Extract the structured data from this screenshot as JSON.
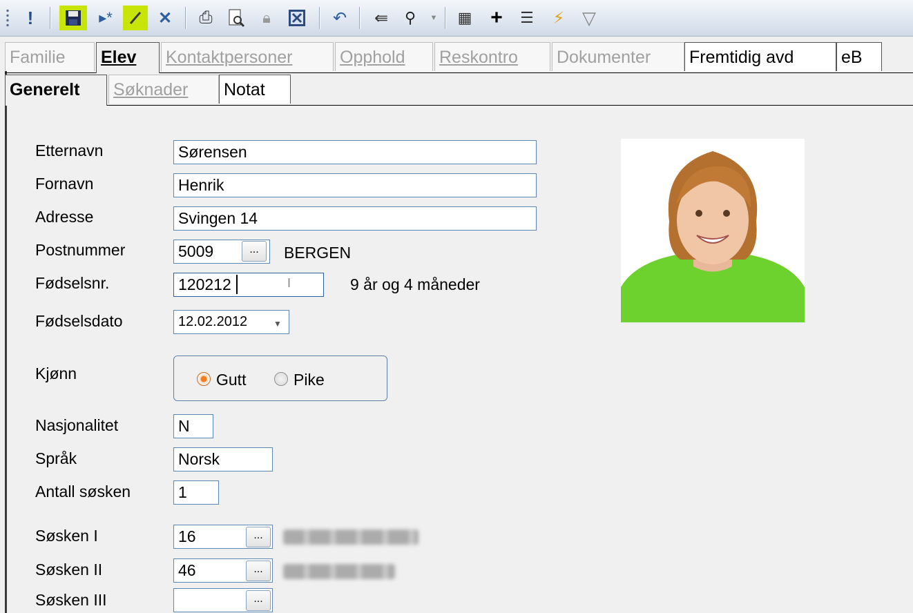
{
  "toolbar": {
    "icons": [
      "grip-icon",
      "exclamation-icon",
      "save-icon",
      "new-record-icon",
      "edit-icon",
      "delete-icon",
      "print-icon",
      "print-preview-icon",
      "lock-icon",
      "excel-icon",
      "undo-icon",
      "import-icon",
      "find-icon",
      "dropdown-icon",
      "properties-icon",
      "add-icon",
      "link-icon",
      "quick-filter-icon",
      "filter-icon"
    ],
    "highlight_color": "#c8e50a"
  },
  "tabs_main": [
    {
      "label": "Familie",
      "state": "disabled"
    },
    {
      "label": "Elev",
      "state": "active"
    },
    {
      "label": "Kontaktpersoner",
      "state": "disabled"
    },
    {
      "label": "Opphold",
      "state": "disabled"
    },
    {
      "label": "Reskontro",
      "state": "disabled"
    },
    {
      "label": "Dokumenter",
      "state": "disabled"
    },
    {
      "label": "Fremtidig avd",
      "state": "normal"
    },
    {
      "label": "eB",
      "state": "normal"
    }
  ],
  "tabs_sub": [
    {
      "label": "Generelt",
      "state": "active"
    },
    {
      "label": "Søknader",
      "state": "disabled"
    },
    {
      "label": "Notat",
      "state": "normal"
    }
  ],
  "form": {
    "etternavn": {
      "label": "Etternavn",
      "value": "Sørensen"
    },
    "fornavn": {
      "label": "Fornavn",
      "value": "Henrik"
    },
    "adresse": {
      "label": "Adresse",
      "value": "Svingen 14"
    },
    "postnummer": {
      "label": "Postnummer",
      "value": "5009",
      "button": "...",
      "city": "BERGEN"
    },
    "fodselsnr": {
      "label": "Fødselsnr.",
      "value": "120212",
      "age": "9 år og 4 måneder"
    },
    "fodselsdato": {
      "label": "Fødselsdato",
      "value": "12.02.2012",
      "dropdown": "▼"
    },
    "kjonn": {
      "label": "Kjønn",
      "options": [
        "Gutt",
        "Pike"
      ],
      "selected": "Gutt"
    },
    "nasjonalitet": {
      "label": "Nasjonalitet",
      "value": "N"
    },
    "sprak": {
      "label": "Språk",
      "value": "Norsk"
    },
    "antall_sosken": {
      "label": "Antall søsken",
      "value": "1"
    },
    "sosken1": {
      "label": "Søsken I",
      "value": "16",
      "button": "..."
    },
    "sosken2": {
      "label": "Søsken II",
      "value": "46",
      "button": "..."
    },
    "sosken3": {
      "label": "Søsken III",
      "value": "",
      "button": "..."
    }
  },
  "accent_color": "#5d86b5"
}
